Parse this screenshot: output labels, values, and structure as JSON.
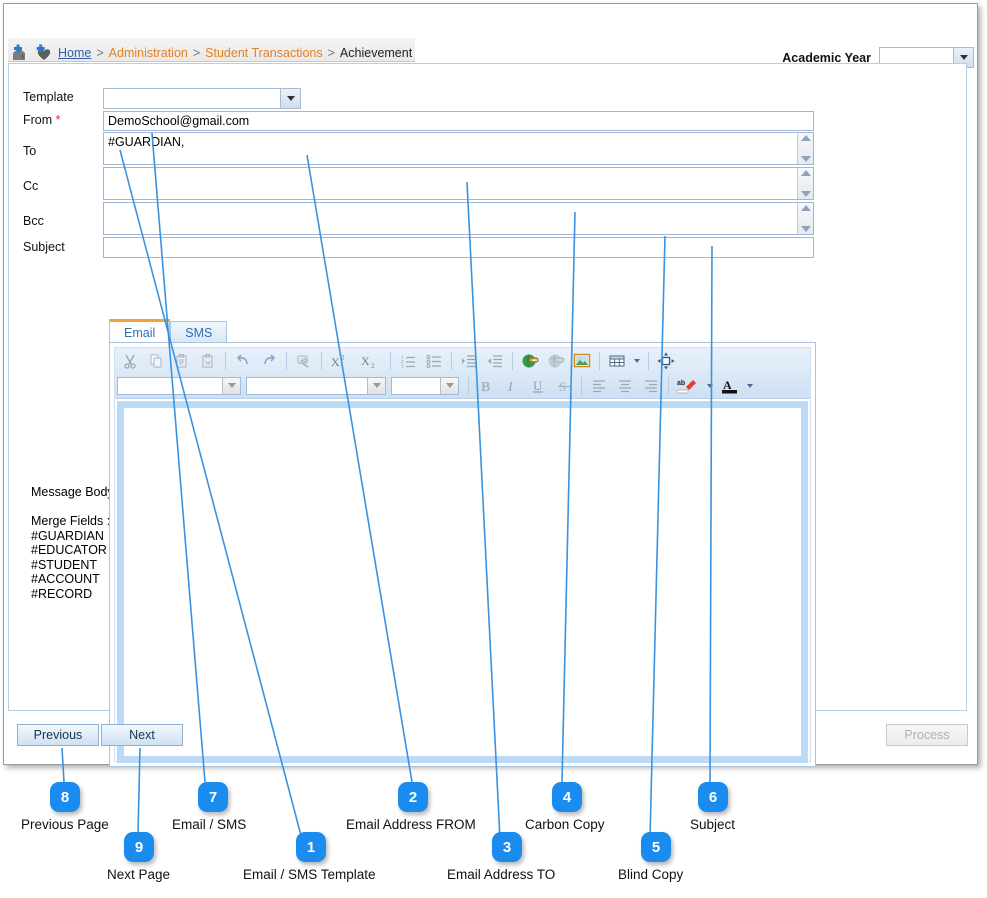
{
  "breadcrumb": {
    "home": "Home",
    "sep": ">",
    "administration": "Administration",
    "student_transactions": "Student Transactions",
    "current": "Achievement"
  },
  "header": {
    "academic_year_label": "Academic Year",
    "academic_year_value": ""
  },
  "form": {
    "template_label": "Template",
    "template_value": "",
    "from_label": "From",
    "from_required": "*",
    "from_value": "DemoSchool@gmail.com",
    "to_label": "To",
    "to_value": "#GUARDIAN,",
    "cc_label": "Cc",
    "cc_value": "",
    "bcc_label": "Bcc",
    "bcc_value": "",
    "subject_label": "Subject",
    "subject_value": ""
  },
  "tabs": [
    {
      "label": "Email",
      "active": true
    },
    {
      "label": "SMS",
      "active": false
    }
  ],
  "editor": {
    "row1_icons": [
      "cut-icon",
      "copy-icon",
      "paste-icon",
      "paste-from-word-icon",
      "undo-icon",
      "redo-icon",
      "spellcheck-icon",
      "superscript-icon",
      "subscript-icon",
      "numbered-list-icon",
      "bulleted-list-icon",
      "decrease-indent-icon",
      "increase-indent-icon",
      "link-icon",
      "unlink-icon",
      "image-icon",
      "table-icon",
      "maximize-icon"
    ],
    "row2_icons": [
      "bold-icon",
      "italic-icon",
      "underline-icon",
      "strikethrough-icon",
      "align-left-icon",
      "align-center-icon",
      "align-right-icon",
      "text-highlight-icon",
      "text-color-icon"
    ],
    "format_dropdown_value": "",
    "font_dropdown_value": "",
    "size_dropdown_value": "",
    "body_value": ""
  },
  "side": {
    "message_body_label": "Message Body",
    "merge_fields_label": "Merge Fields :",
    "merge_fields": [
      "#GUARDIAN",
      "#EDUCATOR",
      "#STUDENT",
      "#ACCOUNT",
      "#RECORD"
    ]
  },
  "footer": {
    "previous_label": "Previous",
    "next_label": "Next",
    "process_label": "Process"
  },
  "callouts": [
    {
      "number": "1",
      "label": "Email / SMS Template"
    },
    {
      "number": "2",
      "label": "Email Address FROM"
    },
    {
      "number": "3",
      "label": "Email Address TO"
    },
    {
      "number": "4",
      "label": "Carbon Copy"
    },
    {
      "number": "5",
      "label": "Blind Copy"
    },
    {
      "number": "6",
      "label": "Subject"
    },
    {
      "number": "7",
      "label": "Email / SMS"
    },
    {
      "number": "8",
      "label": "Previous Page"
    },
    {
      "number": "9",
      "label": "Next Page"
    }
  ],
  "colors": {
    "callout_blue": "#1a8cf0",
    "leader_line": "#3a93e0",
    "tab_accent": "#f0a33c",
    "crumb_link": "#2b5fb0",
    "crumb_mid": "#e08226",
    "required": "#e02020"
  }
}
